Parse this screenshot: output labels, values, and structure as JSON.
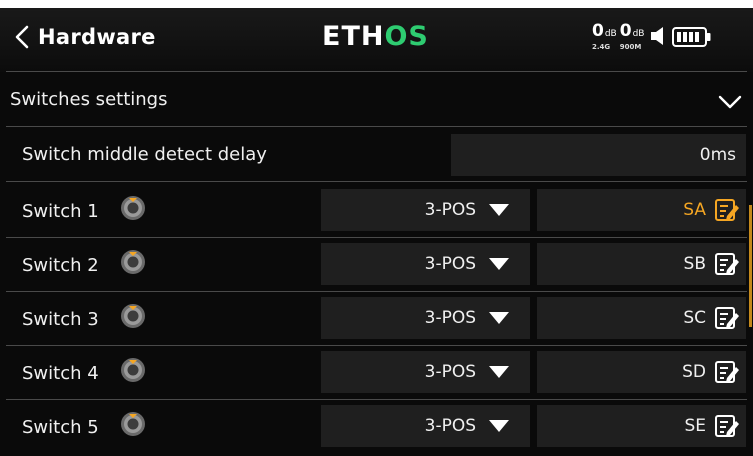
{
  "header": {
    "title": "Hardware",
    "logo_eth": "ETH",
    "logo_os": "OS",
    "rf1_value": "0",
    "rf1_unit": "dB",
    "rf1_band": "2.4G",
    "rf2_value": "0",
    "rf2_unit": "dB",
    "rf2_band": "900M",
    "accent_color": "#2ecc71"
  },
  "section": {
    "label": "Switches settings",
    "expanded": true,
    "icon": "chevron-down-icon"
  },
  "delay": {
    "label": "Switch middle detect delay",
    "value": "0ms"
  },
  "switches": [
    {
      "label": "Switch 1",
      "type": "3-POS",
      "name": "SA",
      "active": true
    },
    {
      "label": "Switch 2",
      "type": "3-POS",
      "name": "SB",
      "active": false
    },
    {
      "label": "Switch 3",
      "type": "3-POS",
      "name": "SC",
      "active": false
    },
    {
      "label": "Switch 4",
      "type": "3-POS",
      "name": "SD",
      "active": false
    },
    {
      "label": "Switch 5",
      "type": "3-POS",
      "name": "SE",
      "active": false
    }
  ],
  "colors": {
    "active_text": "#f5a623",
    "field_bg": "#1f1f1f"
  }
}
